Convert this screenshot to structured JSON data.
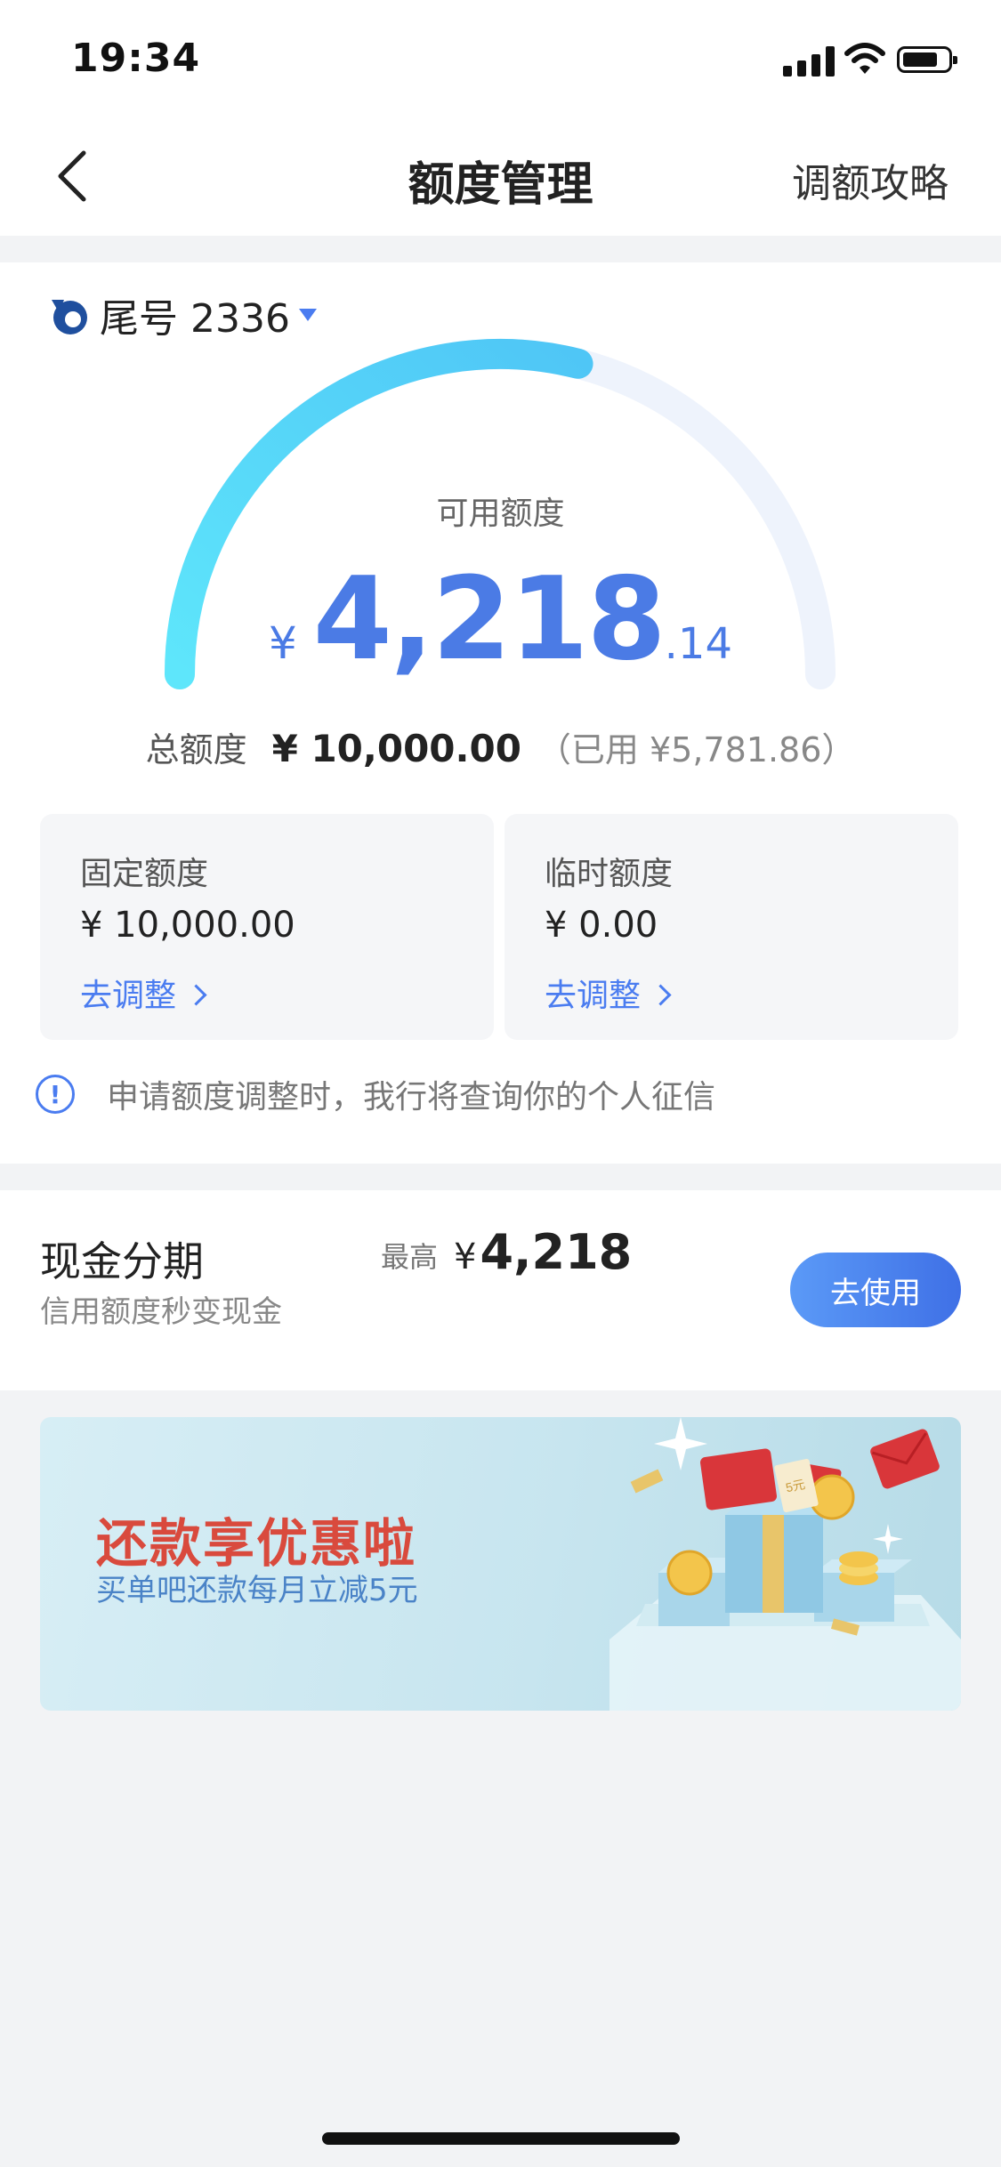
{
  "status_bar": {
    "time": "19:34"
  },
  "nav": {
    "title": "额度管理",
    "right_action": "调额攻略"
  },
  "account": {
    "label": "尾号 2336"
  },
  "credit": {
    "available_label": "可用额度",
    "currency": "¥",
    "available_int": "4,218",
    "available_dec": ".14",
    "used_fraction": 0.5782,
    "total_label": "总额度",
    "total_amount": "¥ 10,000.00",
    "used_text": "（已用 ¥5,781.86）"
  },
  "limits": [
    {
      "title": "固定额度",
      "value": "¥ 10,000.00",
      "link": "去调整"
    },
    {
      "title": "临时额度",
      "value": "¥ 0.00",
      "link": "去调整"
    }
  ],
  "notice": {
    "text": "申请额度调整时，我行将查询你的个人征信"
  },
  "cash_installment": {
    "title": "现金分期",
    "subtitle": "信用额度秒变现金",
    "max_label": "最高",
    "currency": "¥",
    "max_amount": "4,218",
    "button": "去使用"
  },
  "banner": {
    "title": "还款享优惠啦",
    "subtitle": "买单吧还款每月立减5元",
    "tag_text": "5元"
  },
  "colors": {
    "accent": "#4b7be5",
    "gauge_start": "#5ee6fb",
    "gauge_end": "#4fc6f6",
    "track": "#eef3fc",
    "banner_title": "#d94a3d"
  },
  "icons": [
    "back-chevron-icon",
    "cellular-signal-icon",
    "wifi-icon",
    "battery-icon",
    "bank-logo-icon",
    "caret-down-icon",
    "info-icon",
    "chevron-right-icon",
    "gift-box-icon",
    "red-envelope-icon"
  ]
}
